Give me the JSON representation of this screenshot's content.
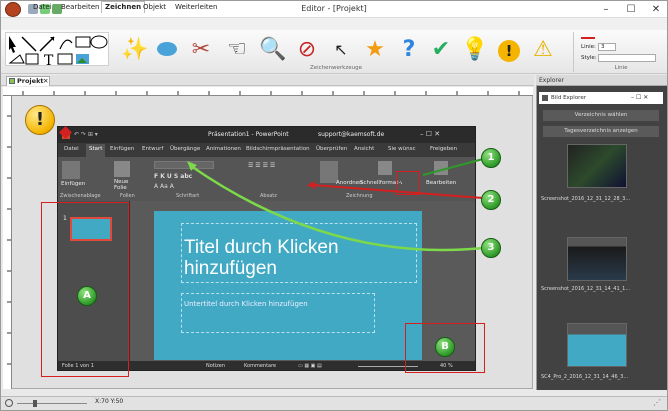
{
  "window": {
    "title": "Editor - [Projekt]",
    "min": "–",
    "max": "☐",
    "close": "✕"
  },
  "menu": [
    "Datei",
    "Bearbeiten",
    "Zeichnen",
    "Objekt",
    "Weiterleiten"
  ],
  "ribbon": {
    "group_tools": "Zeichenwerkzeuge",
    "group_line": "Linie",
    "line_label": "Linie:",
    "line_value": "3",
    "style_label": "Style:"
  },
  "tabs": {
    "doc_tab": "Projekt"
  },
  "explorer": {
    "title": "Explorer",
    "subwin": "Bild Explorer",
    "btn1": "Verzeichnis wählen",
    "btn2": "Tagesverzeichnis anzeigen",
    "items": [
      "Screenshot_2016_12_31_12_28_3...",
      "Screenshot_2016_12_31_14_41_1...",
      "SC4_Pro_2_2016_12_31_14_46_3..."
    ]
  },
  "status": {
    "coords": "X:70 Y:50"
  },
  "pp": {
    "title": "Präsentation1 - PowerPoint",
    "account": "support@kaemsoft.de",
    "tabs": [
      "Datei",
      "Start",
      "Einfügen",
      "Entwurf",
      "Übergänge",
      "Animationen",
      "Bildschirmpräsentation",
      "Überprüfen",
      "Ansicht"
    ],
    "search": "Sie wünsc",
    "share": "Freigeben",
    "paste": "Einfügen",
    "new_slide": "Neue\nFolie",
    "groups": [
      "Zwischenablage",
      "Folien",
      "Schriftart",
      "Absatz",
      "Zeichnung"
    ],
    "arrange": "Anordnen",
    "quickstyles": "Schnellformat-vorlagen",
    "edit": "Bearbeiten",
    "slide_title": "Titel durch Klicken hinzufügen",
    "slide_sub": "Untertitel durch Klicken hinzufügen",
    "status_slide": "Folie 1 von 1",
    "notes": "Notizen",
    "comments": "Kommentare",
    "zoom": "40 %",
    "thumb_num": "1"
  },
  "callouts": {
    "one": "1",
    "two": "2",
    "three": "3",
    "a": "A",
    "b": "B",
    "warn": "!"
  },
  "colors": {
    "accent": "#2f9a2a",
    "red": "#d52020",
    "slide": "#41a9c4"
  }
}
